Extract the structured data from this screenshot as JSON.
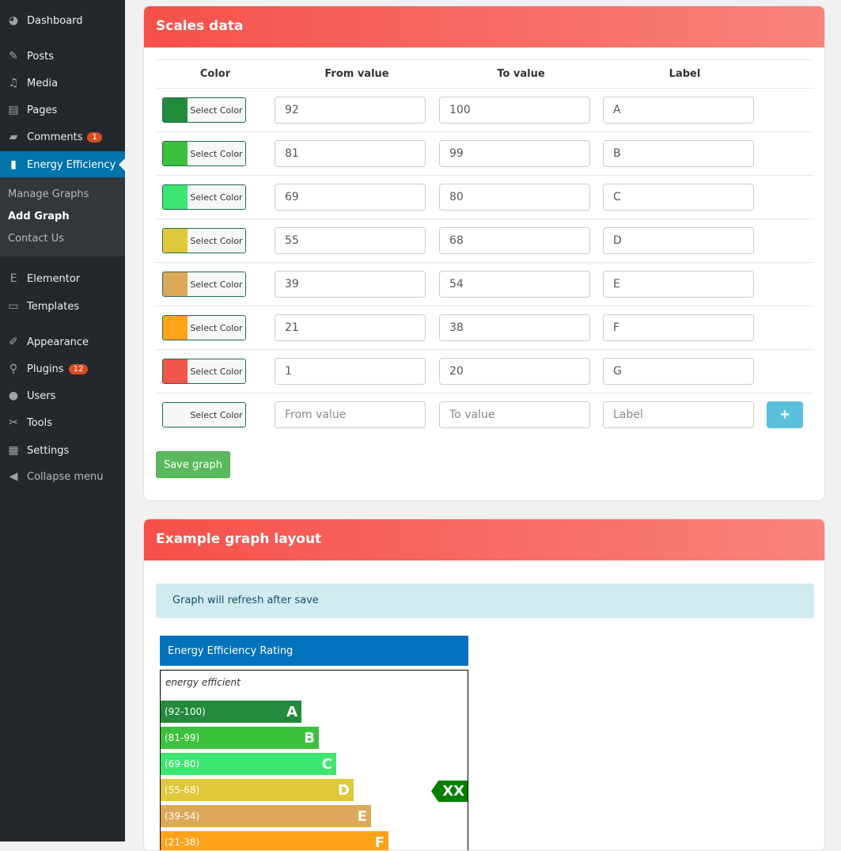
{
  "sidebar": {
    "items": [
      {
        "label": "Dashboard",
        "icon": "dashboard-icon"
      },
      {
        "label": "Posts",
        "icon": "pin-icon"
      },
      {
        "label": "Media",
        "icon": "media-icon"
      },
      {
        "label": "Pages",
        "icon": "pages-icon"
      },
      {
        "label": "Comments",
        "icon": "comment-icon",
        "badge": "1"
      },
      {
        "label": "Energy Efficiency",
        "icon": "bar-chart-icon"
      },
      {
        "label": "Elementor",
        "icon": "elementor-icon"
      },
      {
        "label": "Templates",
        "icon": "folder-icon"
      },
      {
        "label": "Appearance",
        "icon": "brush-icon"
      },
      {
        "label": "Plugins",
        "icon": "plugin-icon",
        "badge": "12"
      },
      {
        "label": "Users",
        "icon": "user-icon"
      },
      {
        "label": "Tools",
        "icon": "wrench-icon"
      },
      {
        "label": "Settings",
        "icon": "settings-icon"
      },
      {
        "label": "Collapse menu",
        "icon": "collapse-icon"
      }
    ],
    "submenu": [
      "Manage Graphs",
      "Add Graph",
      "Contact Us"
    ]
  },
  "scales": {
    "title": "Scales data",
    "headers": {
      "color": "Color",
      "from": "From value",
      "to": "To value",
      "label": "Label"
    },
    "select_color": "Select Color",
    "rows": [
      {
        "color": "#228b3b",
        "from": "92",
        "to": "100",
        "label": "A"
      },
      {
        "color": "#3bc13b",
        "from": "81",
        "to": "99",
        "label": "B"
      },
      {
        "color": "#3de670",
        "from": "69",
        "to": "80",
        "label": "C"
      },
      {
        "color": "#e0c83a",
        "from": "55",
        "to": "68",
        "label": "D"
      },
      {
        "color": "#dca95a",
        "from": "39",
        "to": "54",
        "label": "E"
      },
      {
        "color": "#ffa31a",
        "from": "21",
        "to": "38",
        "label": "F"
      },
      {
        "color": "#f0564a",
        "from": "1",
        "to": "20",
        "label": "G"
      }
    ],
    "new_row": {
      "color": "#f6f7f7",
      "from_placeholder": "From value",
      "to_placeholder": "To value",
      "label_placeholder": "Label",
      "add": "+"
    },
    "save": "Save graph"
  },
  "example": {
    "title": "Example graph layout",
    "alert": "Graph will refresh after save",
    "graph_title": "Energy Efficiency Rating",
    "top_label": "energy efficient",
    "bars": [
      {
        "range": "(92-100)",
        "letter": "A",
        "color": "#228b3b"
      },
      {
        "range": "(81-99)",
        "letter": "B",
        "color": "#3bc13b"
      },
      {
        "range": "(69-80)",
        "letter": "C",
        "color": "#3de670"
      },
      {
        "range": "(55-68)",
        "letter": "D",
        "color": "#e0c83a"
      },
      {
        "range": "(39-54)",
        "letter": "E",
        "color": "#dca95a"
      },
      {
        "range": "(21-38)",
        "letter": "F",
        "color": "#ffa31a"
      }
    ],
    "indicator": "XX",
    "indicator_color": "#008000"
  }
}
